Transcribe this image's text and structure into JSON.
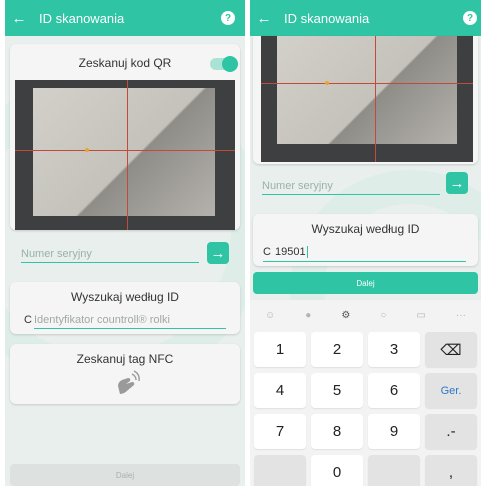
{
  "left": {
    "appbar": {
      "title": "ID skanowania",
      "back_icon": "←",
      "help_icon": "?"
    },
    "qr": {
      "label": "Zeskanuj kod QR",
      "toggle_on": true
    },
    "serial": {
      "placeholder": "Numer seryjny",
      "arrow_icon": "→"
    },
    "search": {
      "heading": "Wyszukaj według ID",
      "prefix": "C",
      "placeholder": "Identyfikator countroll® rolki"
    },
    "nfc": {
      "heading": "Zeskanuj tag NFC",
      "icon": "nfc-icon"
    },
    "next": {
      "label": "Dalej",
      "enabled": false
    }
  },
  "right": {
    "appbar": {
      "title": "ID skanowania",
      "back_icon": "←",
      "help_icon": "?"
    },
    "serial": {
      "placeholder": "Numer seryjny",
      "arrow_icon": "→"
    },
    "search": {
      "heading": "Wyszukaj według ID",
      "prefix": "C",
      "value": "19501"
    },
    "next": {
      "label": "Dalej",
      "enabled": true
    },
    "keyboard": {
      "tools": [
        "☺",
        "●",
        "⚙",
        "○",
        "▭",
        "···"
      ],
      "keys": [
        "1",
        "2",
        "3",
        "⌫",
        "4",
        "5",
        "6",
        "Ger.",
        "7",
        "8",
        "9",
        ".-",
        "",
        "0",
        "",
        ","
      ]
    }
  },
  "colors": {
    "accent": "#2ec4a4",
    "background": "#e9efed",
    "card": "#f5f5f5"
  }
}
